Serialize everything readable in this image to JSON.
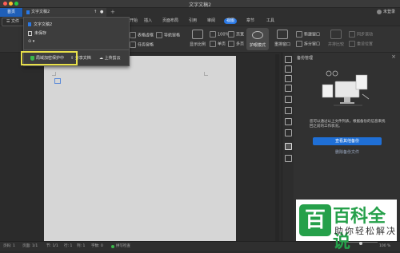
{
  "window": {
    "title": "文字文稿2"
  },
  "tabs": {
    "home": "首页",
    "doc": "文字文稿2",
    "doc_extra1": "↑",
    "doc_extra2": "●",
    "new_tab": "+",
    "account": "未登录"
  },
  "menu": {
    "file": "☰ 文件",
    "items": [
      "开始",
      "插入",
      "页面布局",
      "引用",
      "审阅",
      "视图",
      "章节",
      "工具"
    ],
    "active_index": 5
  },
  "toolbar": {
    "nav_pane": "导航窗格",
    "task_pane": "任务窗格",
    "table_gridlines": "表格虚框",
    "ruler": "标尺",
    "full_screen_display": "显示比例",
    "zoom": "100%",
    "single_page": "单页",
    "multi_page": "多页",
    "page_width": "页宽",
    "eye_protect": "护眼模式",
    "reset_window": "重排窗口",
    "new_window": "新建窗口",
    "split_window": "拆分窗口",
    "side_by_side": "并排比较",
    "sync_scroll": "同步滚动",
    "reset_position": "重设位置"
  },
  "dropdown": {
    "items": [
      "文字文稿2",
      "未保存",
      "⊙ ▾"
    ],
    "actions": {
      "protect": "局域加密保护中",
      "share": "分享文档",
      "upload": "上传剪云"
    }
  },
  "panel": {
    "title": "备份管理",
    "description": "您可以通过以上文件列表，根据备份的信息来找回之前的工作状况。",
    "primary_button": "查看其他备份",
    "secondary_button": "删除备份文件"
  },
  "statusbar": {
    "pages": "页码: 1",
    "section": "页面: 1/1",
    "section2": "节: 1/1",
    "row": "行: 1",
    "col": "列: 1",
    "words": "字数: 0",
    "spell": "拼写检查",
    "zoom": "100 %"
  },
  "watermark": {
    "logo_char": "百",
    "title": "百科全说",
    "subtitle": "助你轻松解决"
  },
  "colors": {
    "accent": "#2a78e4",
    "highlight": "#e8e04a",
    "shield": "#3cb84a",
    "watermark_green": "#25a04a"
  }
}
